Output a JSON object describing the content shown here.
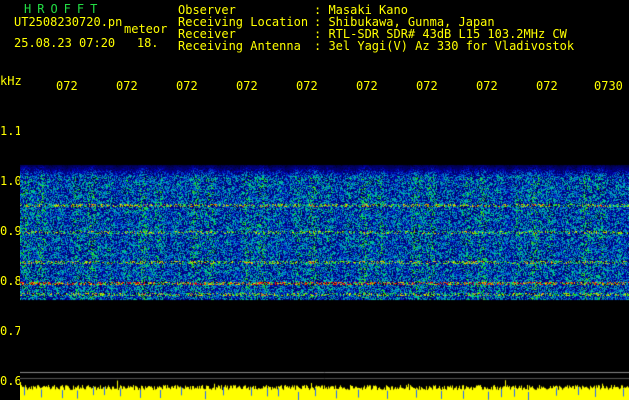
{
  "header": {
    "logo": "HROFFT",
    "filename": "UT2508230720.pn",
    "suffix": "meteor",
    "datetime": "25.08.23 07:20",
    "count": "18.",
    "fields": [
      {
        "key": "Observer",
        "value": ": Masaki Kano"
      },
      {
        "key": "Receiving Location",
        "value": ": Shibukawa, Gunma, Japan"
      },
      {
        "key": "Receiver",
        "value": ": RTL-SDR SDR# 43dB L15 103.2MHz CW"
      },
      {
        "key": "Receiving Antenna",
        "value": ": 3el Yagi(V) Az 330 for Vladivostok"
      }
    ]
  },
  "xticks": [
    "072",
    "072",
    "072",
    "072",
    "072",
    "072",
    "072",
    "072",
    "072",
    "0730"
  ],
  "yticks": [
    "1.1",
    "1.0",
    "0.9",
    "0.8",
    "0.7",
    "0.6"
  ],
  "yunit": "kHz",
  "colors": {
    "text": "#ffff00",
    "logo": "#22dd44",
    "background": "#000000"
  }
}
